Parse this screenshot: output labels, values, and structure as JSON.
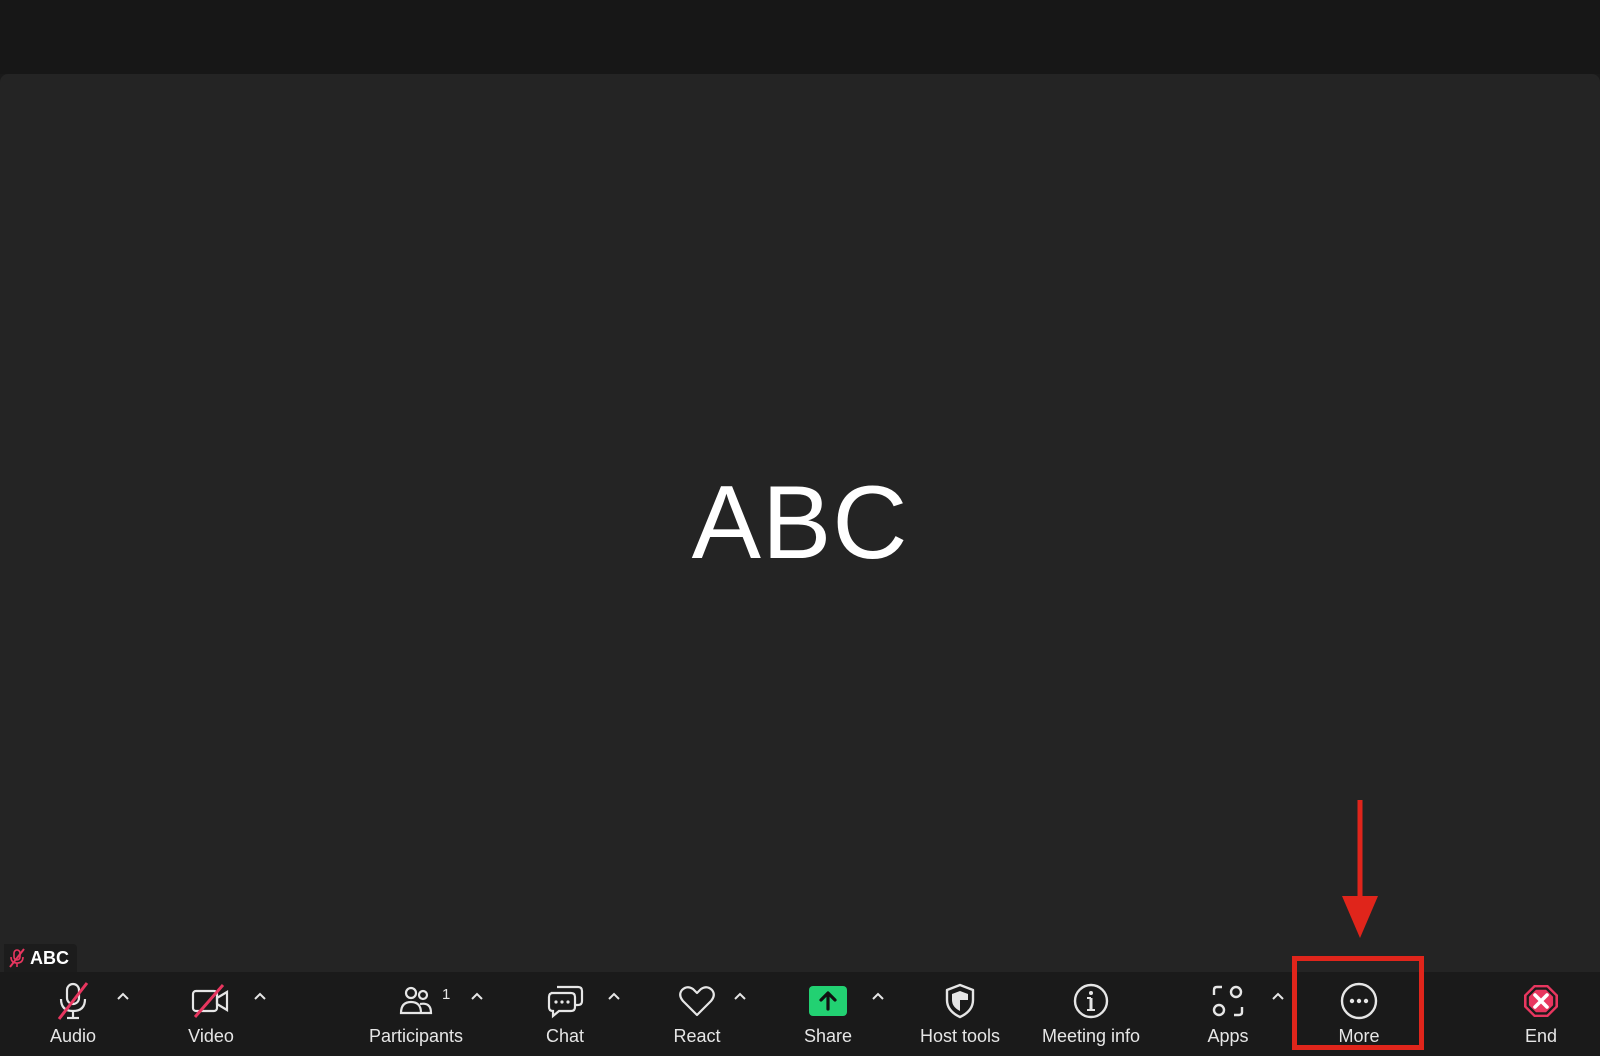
{
  "participant": {
    "display_name": "ABC",
    "name_tag": "ABC"
  },
  "toolbar": {
    "audio": {
      "label": "Audio",
      "icon": "microphone-muted-icon"
    },
    "video": {
      "label": "Video",
      "icon": "camera-off-icon"
    },
    "participants": {
      "label": "Participants",
      "count": "1",
      "icon": "participants-icon"
    },
    "chat": {
      "label": "Chat",
      "icon": "chat-icon"
    },
    "react": {
      "label": "React",
      "icon": "heart-icon"
    },
    "share": {
      "label": "Share",
      "icon": "share-screen-icon"
    },
    "host_tools": {
      "label": "Host tools",
      "icon": "shield-icon"
    },
    "meeting_info": {
      "label": "Meeting info",
      "icon": "info-icon"
    },
    "apps": {
      "label": "Apps",
      "icon": "apps-icon"
    },
    "more": {
      "label": "More",
      "icon": "more-icon"
    },
    "end": {
      "label": "End",
      "icon": "end-icon"
    }
  },
  "colors": {
    "background": "#242424",
    "toolbar": "#1a1a1a",
    "muted_slash": "#e8365f",
    "share_green": "#22d172",
    "end_red": "#e8365f",
    "annotation_red": "#e0251b"
  }
}
